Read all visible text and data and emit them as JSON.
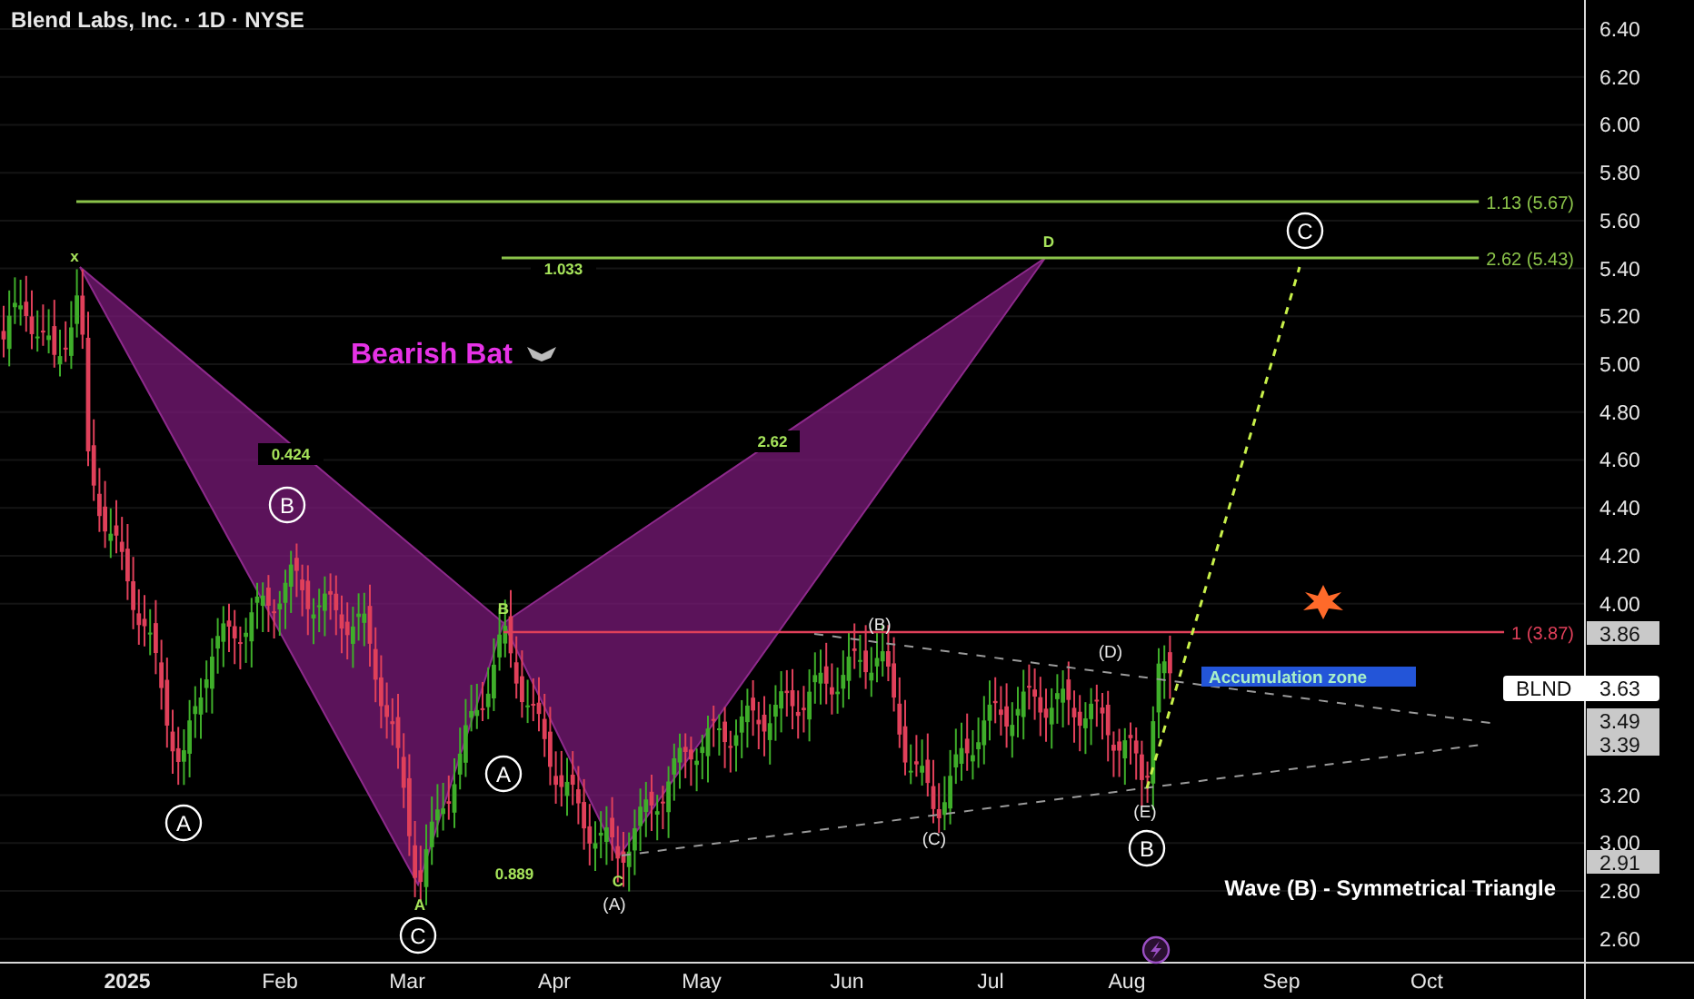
{
  "header": {
    "title": "Blend Labs, Inc. · 1D · NYSE"
  },
  "price_axis": [
    "6.40",
    "6.20",
    "6.00",
    "5.80",
    "5.60",
    "5.40",
    "5.20",
    "5.00",
    "4.80",
    "4.60",
    "4.40",
    "4.20",
    "4.00",
    "3.20",
    "3.00",
    "2.80",
    "2.60"
  ],
  "time_axis": [
    {
      "label": "2025",
      "kind": "year"
    },
    {
      "label": "Feb",
      "kind": "month"
    },
    {
      "label": "Mar",
      "kind": "month"
    },
    {
      "label": "Apr",
      "kind": "month"
    },
    {
      "label": "May",
      "kind": "month"
    },
    {
      "label": "Jun",
      "kind": "month"
    },
    {
      "label": "Jul",
      "kind": "month"
    },
    {
      "label": "Aug",
      "kind": "month"
    },
    {
      "label": "Sep",
      "kind": "month"
    },
    {
      "label": "Oct",
      "kind": "month"
    }
  ],
  "price_tags": [
    "3.86",
    "3.49",
    "3.39",
    "2.91"
  ],
  "symbol_tag": {
    "symbol": "BLND",
    "price": "3.63"
  },
  "pattern": {
    "title": "Bearish Bat",
    "points": [
      "x",
      "A",
      "B",
      "C",
      "D"
    ],
    "ratios": [
      "0.424",
      "2.62",
      "0.889",
      "1.033"
    ]
  },
  "levels": [
    {
      "label": "1.13 (5.67)",
      "color": "#8bc34a"
    },
    {
      "label": "2.62 (5.43)",
      "color": "#8bc34a"
    },
    {
      "label": "1 (3.87)",
      "color": "#e0405a"
    }
  ],
  "circled_labels": [
    "B",
    "A",
    "A",
    "C",
    "B",
    "C"
  ],
  "wave_labels": [
    "(B)",
    "(D)",
    "(A)",
    "(C)",
    "(E)"
  ],
  "note": "Accumulation zone",
  "caption": "Wave (B) - Symmetrical Triangle"
}
